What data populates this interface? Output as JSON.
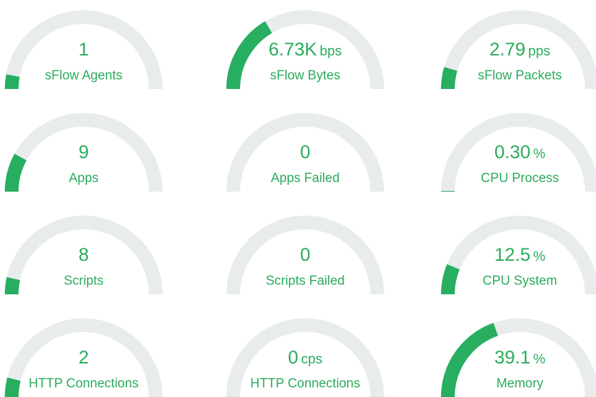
{
  "colors": {
    "fill": "#27ae60",
    "track": "#e9eced",
    "text": "#2bab5c"
  },
  "gauges": [
    {
      "value": "1",
      "unit": "",
      "label": "sFlow Agents",
      "fraction": 0.06
    },
    {
      "value": "6.73K",
      "unit": "bps",
      "label": "sFlow Bytes",
      "fraction": 0.33
    },
    {
      "value": "2.79",
      "unit": "pps",
      "label": "sFlow Packets",
      "fraction": 0.09
    },
    {
      "value": "9",
      "unit": "",
      "label": "Apps",
      "fraction": 0.16
    },
    {
      "value": "0",
      "unit": "",
      "label": "Apps Failed",
      "fraction": 0
    },
    {
      "value": "0.30",
      "unit": "%",
      "label": "CPU Process",
      "fraction": 0.003
    },
    {
      "value": "8",
      "unit": "",
      "label": "Scripts",
      "fraction": 0.07
    },
    {
      "value": "0",
      "unit": "",
      "label": "Scripts Failed",
      "fraction": 0
    },
    {
      "value": "12.5",
      "unit": "%",
      "label": "CPU System",
      "fraction": 0.125
    },
    {
      "value": "2",
      "unit": "",
      "label": "HTTP Connections",
      "fraction": 0.08
    },
    {
      "value": "0",
      "unit": "cps",
      "label": "HTTP Connections",
      "fraction": 0
    },
    {
      "value": "39.1",
      "unit": "%",
      "label": "Memory",
      "fraction": 0.391
    }
  ]
}
